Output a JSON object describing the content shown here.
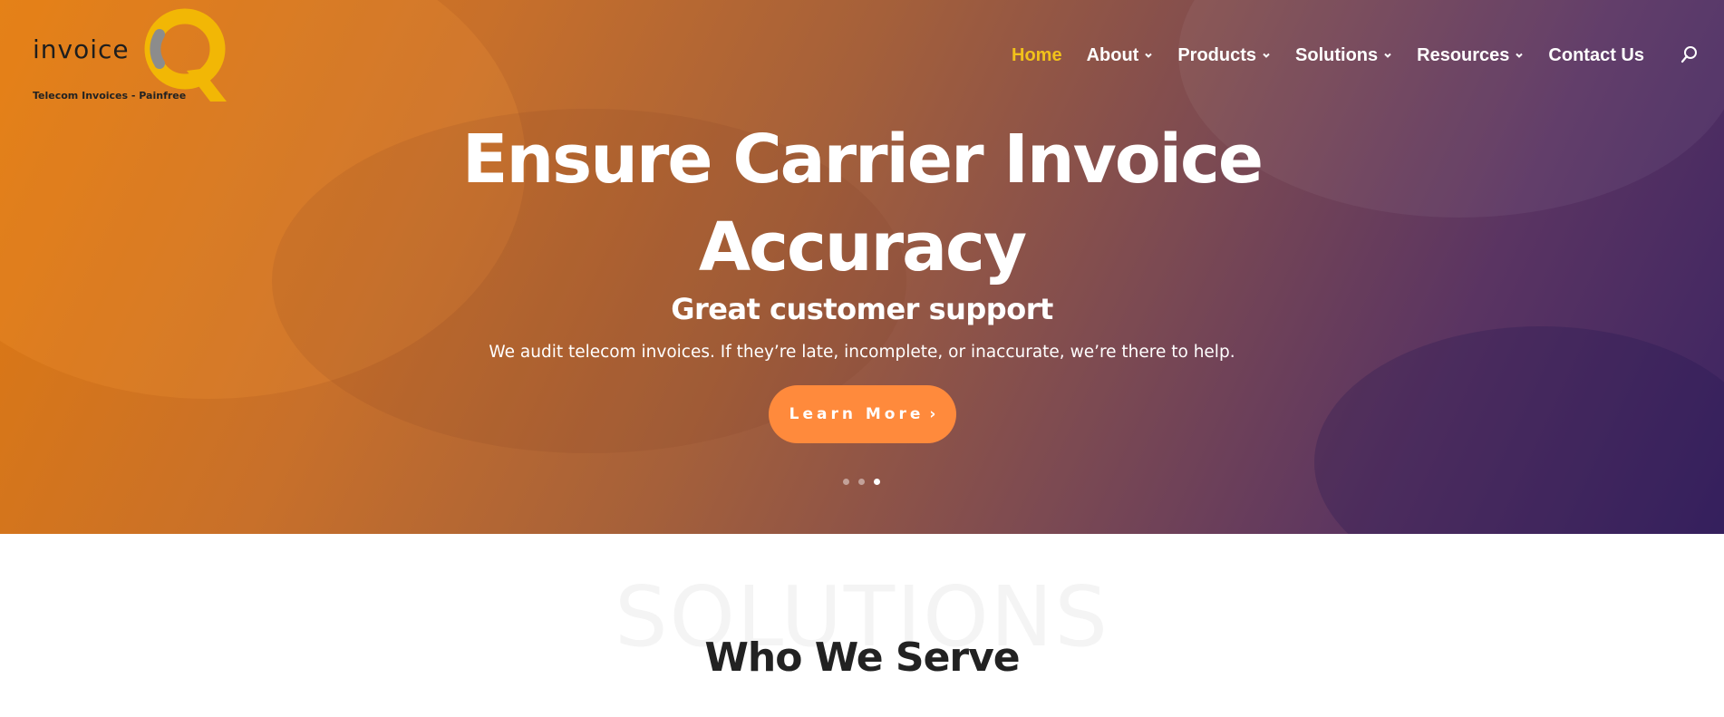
{
  "header": {
    "logo": {
      "word": "invoice",
      "letter": "Q",
      "tagline": "Telecom Invoices - Painfree"
    },
    "nav": [
      {
        "label": "Home",
        "active": true,
        "has_dropdown": false
      },
      {
        "label": "About",
        "active": false,
        "has_dropdown": true
      },
      {
        "label": "Products",
        "active": false,
        "has_dropdown": true
      },
      {
        "label": "Solutions",
        "active": false,
        "has_dropdown": true
      },
      {
        "label": "Resources",
        "active": false,
        "has_dropdown": true
      },
      {
        "label": "Contact Us",
        "active": false,
        "has_dropdown": false
      }
    ],
    "search_icon": "search-icon"
  },
  "hero": {
    "title": "Ensure Carrier Invoice Accuracy",
    "subtitle": "Great customer support",
    "description": "We audit telecom invoices. If they’re late, incomplete, or inaccurate, we’re there to help.",
    "cta": {
      "label": "Learn More",
      "icon": "chevron-right-icon"
    },
    "slider": {
      "count": 3,
      "active_index": 2
    }
  },
  "section": {
    "watermark": "SOLUTIONS",
    "title": "Who We Serve"
  },
  "colors": {
    "active_nav": "#f2c21a",
    "cta_background": "#ff8a3c",
    "hero_gradient_start": "#e07a0f",
    "hero_gradient_end": "#3c2462",
    "logo_q_yellow": "#f2b705",
    "logo_q_gray": "#8c8c8c"
  }
}
